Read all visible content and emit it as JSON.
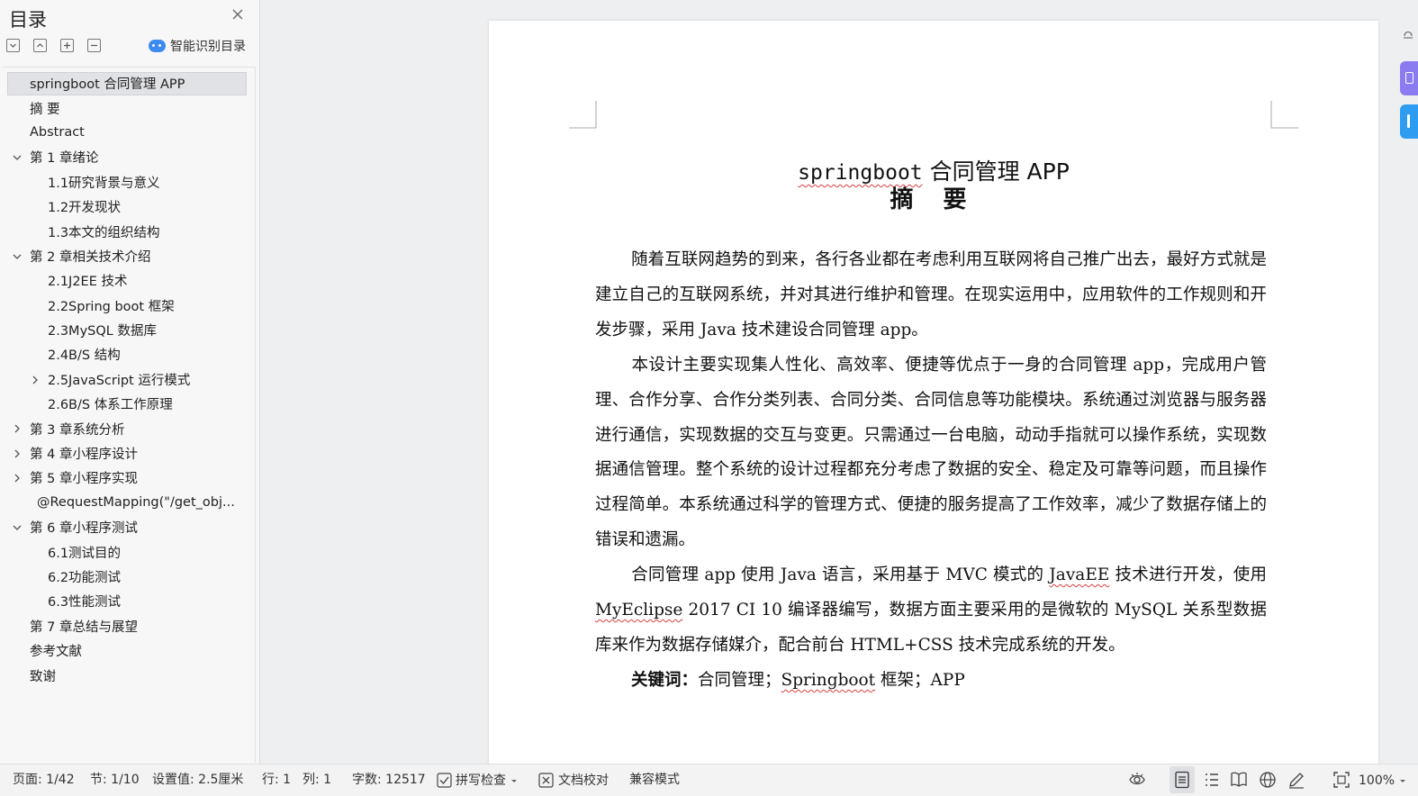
{
  "sidebar": {
    "title": "目录",
    "smart_toc_label": "智能识别目录",
    "toc": [
      {
        "label": "springboot 合同管理 APP",
        "level": 0,
        "selected": true,
        "expander": "none"
      },
      {
        "label": "摘  要",
        "level": 0,
        "expander": "none"
      },
      {
        "label": "Abstract",
        "level": 0,
        "expander": "none"
      },
      {
        "label": "第 1 章绪论",
        "level": 0,
        "expander": "expanded"
      },
      {
        "label": "1.1研究背景与意义",
        "level": 1,
        "expander": "none"
      },
      {
        "label": "1.2开发现状",
        "level": 1,
        "expander": "none"
      },
      {
        "label": "1.3本文的组织结构",
        "level": 1,
        "expander": "none"
      },
      {
        "label": "第 2 章相关技术介绍",
        "level": 0,
        "expander": "expanded"
      },
      {
        "label": "2.1J2EE 技术",
        "level": 1,
        "expander": "none"
      },
      {
        "label": "2.2Spring boot 框架",
        "level": 1,
        "expander": "none"
      },
      {
        "label": "2.3MySQL 数据库",
        "level": 1,
        "expander": "none"
      },
      {
        "label": "2.4B/S 结构",
        "level": 1,
        "expander": "none"
      },
      {
        "label": "2.5JavaScript  运行模式",
        "level": 1,
        "expander": "collapsed"
      },
      {
        "label": "2.6B/S 体系工作原理",
        "level": 1,
        "expander": "none"
      },
      {
        "label": "第 3 章系统分析",
        "level": 0,
        "expander": "collapsed"
      },
      {
        "label": "第 4 章小程序设计",
        "level": 0,
        "expander": "collapsed"
      },
      {
        "label": "第 5 章小程序实现",
        "level": 0,
        "expander": "collapsed"
      },
      {
        "label": "@RequestMapping(\"/get_obj...",
        "level": 0.5,
        "expander": "none"
      },
      {
        "label": "第 6 章小程序测试",
        "level": 0,
        "expander": "expanded"
      },
      {
        "label": "6.1测试目的",
        "level": 1,
        "expander": "none"
      },
      {
        "label": "6.2功能测试",
        "level": 1,
        "expander": "none"
      },
      {
        "label": "6.3性能测试",
        "level": 1,
        "expander": "none"
      },
      {
        "label": "第 7 章总结与展望",
        "level": 0,
        "expander": "none"
      },
      {
        "label": "参考文献",
        "level": 0,
        "expander": "none"
      },
      {
        "label": "致谢",
        "level": 0,
        "expander": "none"
      }
    ]
  },
  "document": {
    "title_prefix": "springboot",
    "title_rest": " 合同管理 APP",
    "heading": "摘 要",
    "p1": "随着互联网趋势的到来，各行各业都在考虑利用互联网将自己推广出去，最好方式就是建立自己的互联网系统，并对其进行维护和管理。在现实运用中，应用软件的工作规则和开发步骤，采用 Java 技术建设合同管理 app。",
    "p2": "本设计主要实现集人性化、高效率、便捷等优点于一身的合同管理 app，完成用户管理、合作分享、合作分类列表、合同分类、合同信息等功能模块。系统通过浏览器与服务器进行通信，实现数据的交互与变更。只需通过一台电脑，动动手指就可以操作系统，实现数据通信管理。整个系统的设计过程都充分考虑了数据的安全、稳定及可靠等问题，而且操作过程简单。本系统通过科学的管理方式、便捷的服务提高了工作效率，减少了数据存储上的错误和遗漏。",
    "p3_a": "合同管理 app 使用 Java 语言，采用基于  MVC 模式的 ",
    "p3_javaee": "JavaEE",
    "p3_b": " 技术进行开发，使用 ",
    "p3_myeclipse": "MyEclipse",
    "p3_c": " 2017 CI 10  编译器编写，数据方面主要采用的是微软的 MySQL 关系型数据库来作为数据存储媒介，配合前台 HTML+CSS  技术完成系统的开发。",
    "kw_label": "关键词：",
    "kw_a": "合同管理；",
    "kw_springboot": "Springboot",
    "kw_b": " 框架；APP"
  },
  "statusbar": {
    "page": "页面: 1/42",
    "section": "节: 1/10",
    "setting": "设置值: 2.5厘米",
    "row": "行: 1",
    "col": "列: 1",
    "words": "字数: 12517",
    "spellcheck": "拼写检查",
    "proofread": "文档校对",
    "compat": "兼容模式",
    "zoom": "100%"
  },
  "colors": {
    "accent": "#3d8bf0",
    "squiggle": "#d84040",
    "right_tab_purple": "#8a7cf0",
    "right_tab_blue": "#2e9cf0"
  }
}
